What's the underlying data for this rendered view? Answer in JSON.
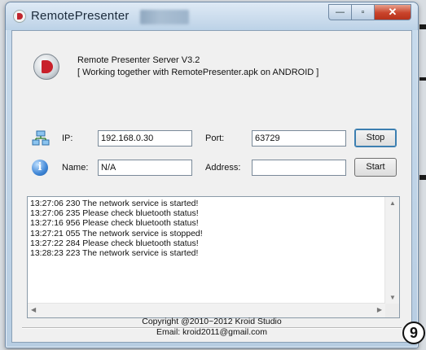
{
  "window": {
    "title": "RemotePresenter",
    "min_glyph": "—",
    "max_glyph": "▫",
    "close_glyph": "✕"
  },
  "header": {
    "title": "Remote Presenter Server V3.2",
    "subtitle": "[ Working together with RemotePresenter.apk on ANDROID ]"
  },
  "form": {
    "ip_label": "IP:",
    "ip_value": "192.168.0.30",
    "port_label": "Port:",
    "port_value": "63729",
    "name_label": "Name:",
    "name_value": "N/A",
    "address_label": "Address:",
    "address_value": "",
    "stop_label": "Stop",
    "start_label": "Start"
  },
  "log": {
    "lines": [
      "13:27:06 230  The network service is started!",
      "13:27:06 235  Please check bluetooth status!",
      "13:27:16 956  Please check bluetooth status!",
      "13:27:21 055  The network service is stopped!",
      "13:27:22 284  Please check bluetooth status!",
      "13:28:23 223  The network service is started!"
    ]
  },
  "footer": {
    "copyright": "Copyright @2010~2012 Kroid Studio",
    "email": "Email: kroid2011@gmail.com"
  },
  "badge": "9",
  "icons": {
    "app": "remote-presenter-logo",
    "network": "network-icon",
    "info": "info-icon"
  }
}
